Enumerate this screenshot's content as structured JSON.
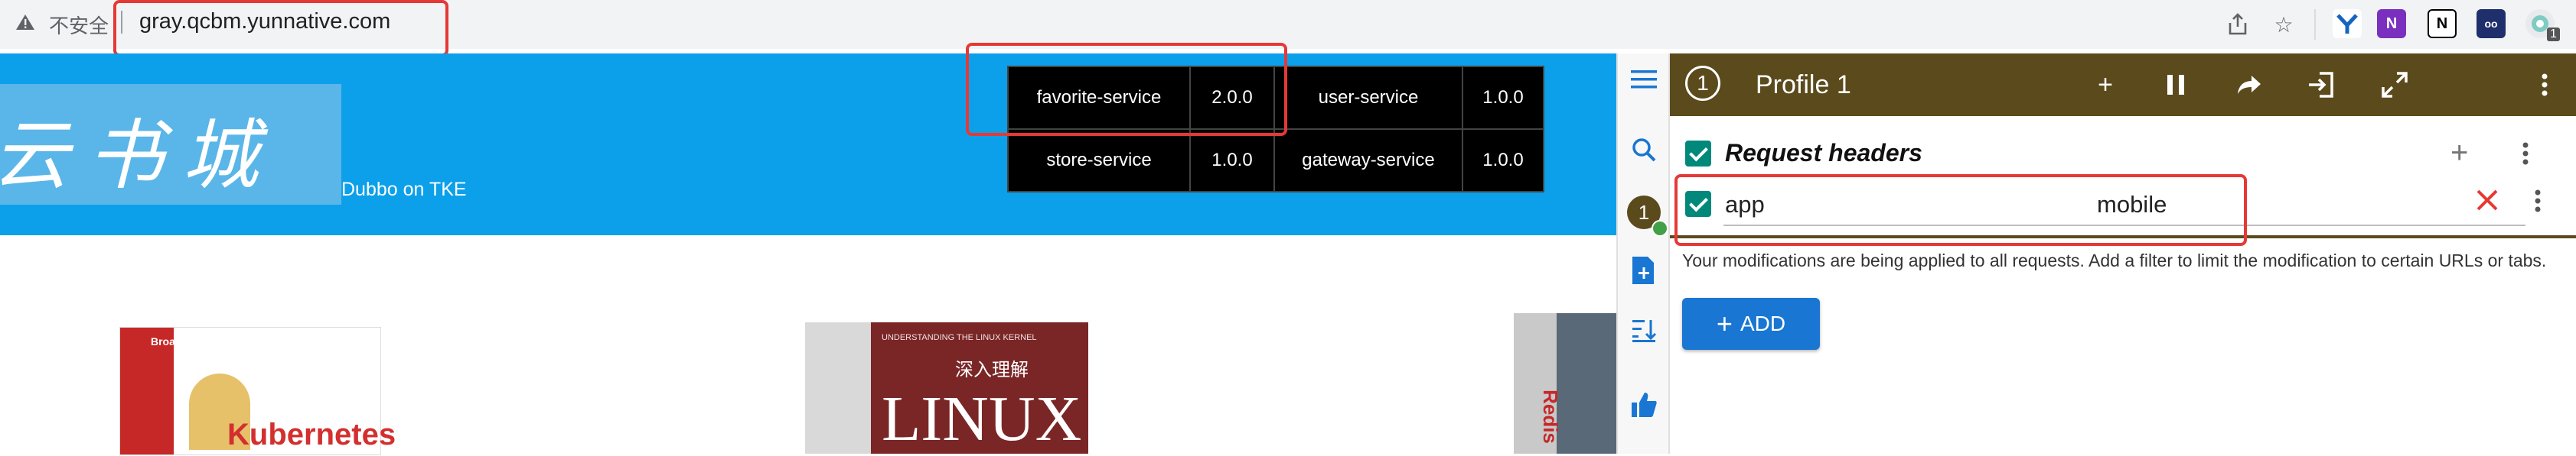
{
  "browser": {
    "insecure_label": "不安全",
    "url": "gray.qcbm.yunnative.com",
    "extension_badge": "1"
  },
  "site": {
    "logo_text": "云书城",
    "subtitle": "Dubbo on TKE",
    "services": [
      {
        "name": "favorite-service",
        "version": "2.0.0"
      },
      {
        "name": "user-service",
        "version": "1.0.0"
      },
      {
        "name": "store-service",
        "version": "1.0.0"
      },
      {
        "name": "gateway-service",
        "version": "1.0.0"
      }
    ],
    "books": [
      {
        "title": "Kubernetes",
        "publisher": "Broadview"
      },
      {
        "title": "LINUX",
        "subtitle": "深入理解",
        "series": "UNDERSTANDING THE LINUX KERNEL"
      },
      {
        "title": "Redis"
      }
    ]
  },
  "modheader": {
    "profile_number": "1",
    "profile_name": "Profile 1",
    "side_badge": "1",
    "section_label": "Request headers",
    "header_name": "app",
    "header_value": "mobile",
    "note": "Your modifications are being applied to all requests. Add a filter to limit the modification to certain URLs or tabs.",
    "add_label": "ADD",
    "header_color": "#5b4a1c",
    "accent_color": "#1976d2",
    "check_color": "#00897b"
  }
}
